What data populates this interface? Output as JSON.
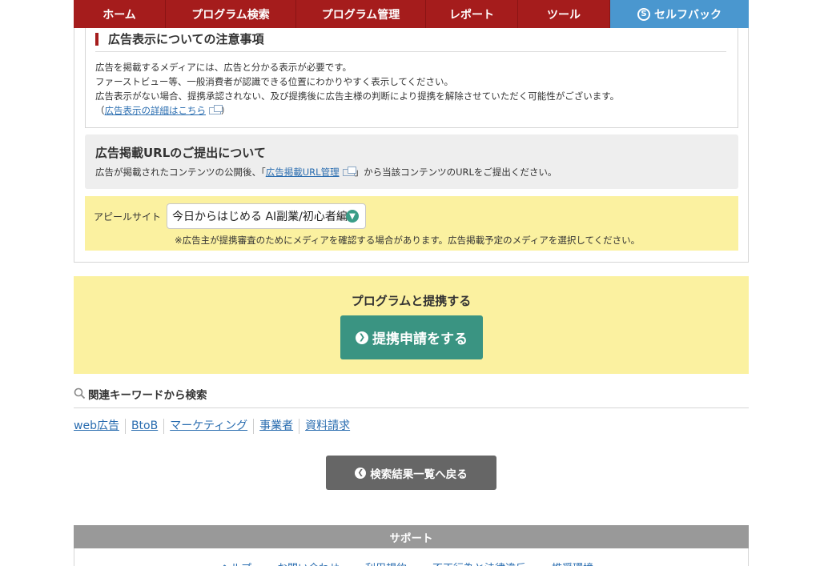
{
  "nav": {
    "items": [
      "ホーム",
      "プログラム検索",
      "プログラム管理",
      "レポート",
      "ツール",
      "セルフバック"
    ]
  },
  "notice": {
    "title": "広告表示についての注意事項",
    "line1": "広告を掲載するメディアには、広告と分かる表示が必要です。",
    "line2": "ファーストビュー等、一般消費者が認識できる位置にわかりやすく表示してください。",
    "line3": "広告表示がない場合、提携承認されない、及び提携後に広告主様の判断により提携を解除させていただく可能性がございます。",
    "link_open": "（",
    "link": "広告表示の詳細はこちら",
    "link_close": "）"
  },
  "url_submit": {
    "title": "広告掲載URLのご提出について",
    "text_before": "広告が掲載されたコンテンツの公開後、「",
    "link": "広告掲載URL管理",
    "text_after": "」から当該コンテンツのURLをご提出ください。"
  },
  "appeal": {
    "label": "アピールサイト",
    "selected": "今日からはじめる AI副業/初心者編",
    "note": "※広告主が提携審査のためにメディアを確認する場合があります。広告掲載予定のメディアを選択してください。"
  },
  "apply": {
    "heading": "プログラムと提携する",
    "button": "提携申請をする"
  },
  "keywords": {
    "heading": "関連キーワードから検索",
    "items": [
      "web広告",
      "BtoB",
      "マーケティング",
      "事業者",
      "資料請求"
    ]
  },
  "back_button": "検索結果一覧へ戻る",
  "support": {
    "title": "サポート",
    "links": [
      "ヘルプ",
      "お問い合わせ",
      "利用規約",
      "不正行為と法律違反",
      "推奨環境"
    ]
  },
  "colors": {
    "nav_red": "#a51c1c",
    "nav_blue": "#4a97cf",
    "yellow": "#fbf1a0",
    "teal": "#3a9482",
    "link": "#2a6db0"
  }
}
